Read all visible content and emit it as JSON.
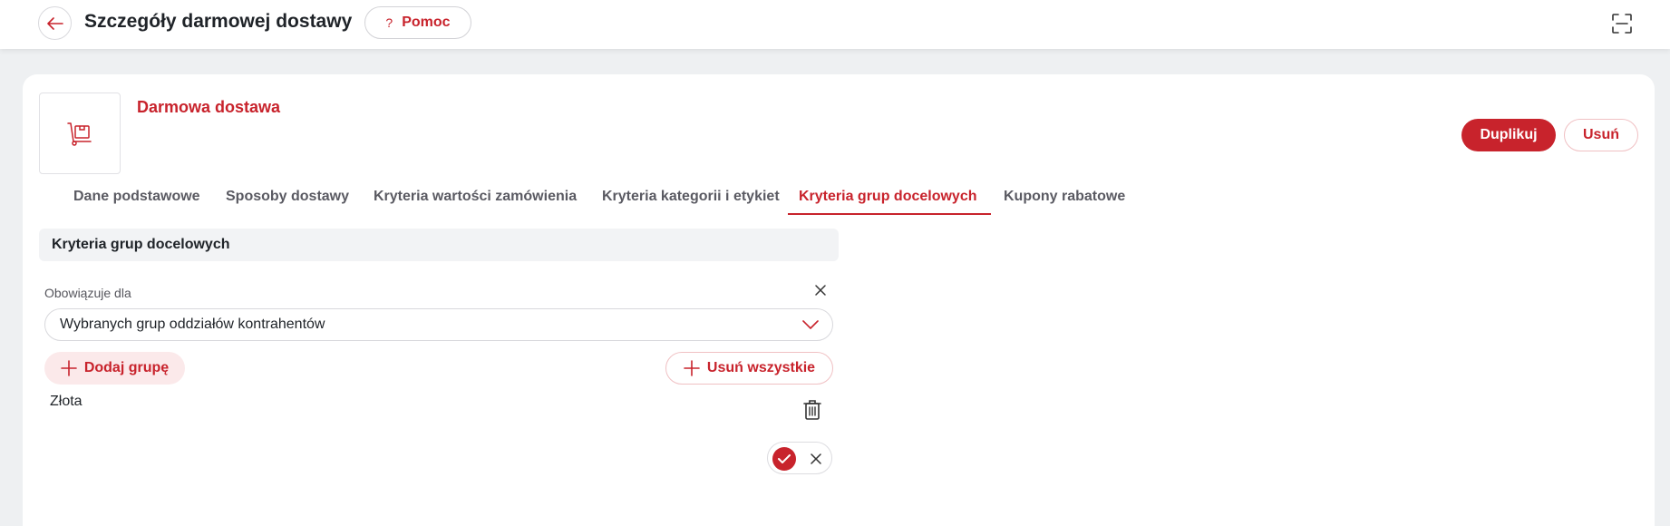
{
  "header": {
    "title": "Szczegóły darmowej dostawy",
    "help_label": "Pomoc",
    "help_glyph": "?"
  },
  "entity": {
    "name": "Darmowa dostawa",
    "icon": "delivery-trolley-icon"
  },
  "actions": {
    "duplicate_label": "Duplikuj",
    "delete_label": "Usuń"
  },
  "tabs": [
    {
      "label": "Dane podstawowe"
    },
    {
      "label": "Sposoby dostawy"
    },
    {
      "label": "Kryteria wartości zamówienia"
    },
    {
      "label": "Kryteria kategorii i etykiet"
    },
    {
      "label": "Kryteria grup docelowych",
      "active": true
    },
    {
      "label": "Kupony rabatowe"
    }
  ],
  "section": {
    "title": "Kryteria grup docelowych",
    "applies_label": "Obowiązuje dla",
    "applies_value": "Wybranych grup oddziałów kontrahentów",
    "add_group_label": "Dodaj grupę",
    "remove_all_label": "Usuń wszystkie",
    "groups": [
      {
        "name": "Złota"
      }
    ]
  },
  "colors": {
    "accent": "#c8232c",
    "accent_light": "#fbe9ea",
    "background": "#eef0f2"
  }
}
